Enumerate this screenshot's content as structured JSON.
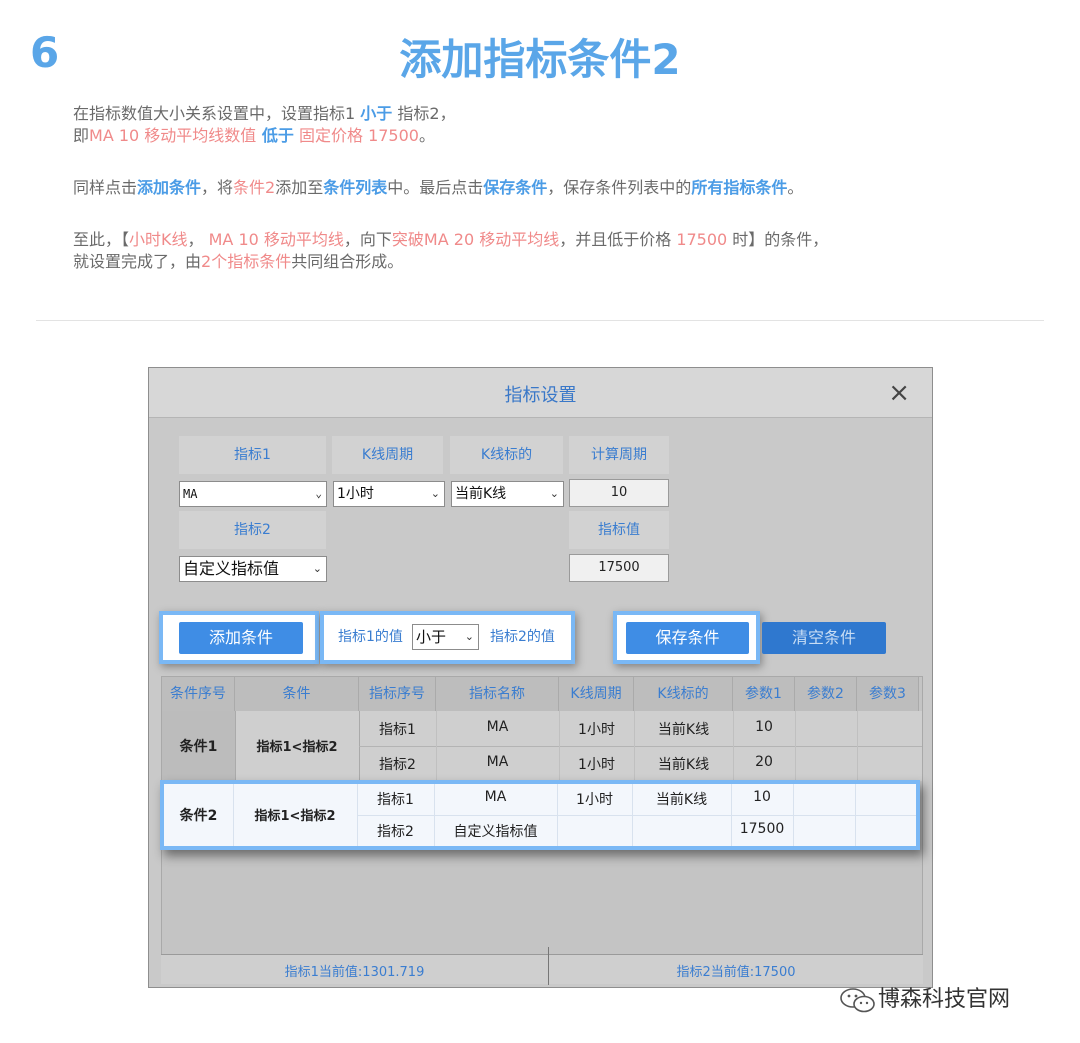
{
  "article": {
    "step_number": "6",
    "title": "添加指标条件2",
    "para1": {
      "line1_a": "在指标数值大小关系设置中，设置指标1 ",
      "line1_b": "小于",
      "line1_c": " 指标2，",
      "line2_a": "即",
      "line2_b": "MA 10 移动平均线数值",
      "line2_c": " 低于",
      "line2_d": " 固定价格 17500",
      "line2_e": "。"
    },
    "para2": {
      "a": "同样点击",
      "b": "添加条件",
      "c": "，将",
      "d": "条件2",
      "e": "添加至",
      "f": "条件列表",
      "g": "中。最后点击",
      "h": "保存条件",
      "i": "，保存条件列表中的",
      "j": "所有指标条件",
      "k": "。"
    },
    "para3": {
      "line1_a": "至此，【",
      "line1_b": "小时K线",
      "line1_c": "， ",
      "line1_d": "MA 10 移动平均线",
      "line1_e": "，向下",
      "line1_f": "突破MA 20 移动平均线",
      "line1_g": "，并且低于价格 ",
      "line1_h": "17500",
      "line1_i": " 时】的条件，",
      "line2_a": "就设置完成了，由",
      "line2_b": "2个指标条件",
      "line2_c": "共同组合形成。"
    }
  },
  "dialog": {
    "title": "指标设置",
    "close": "×",
    "labels": {
      "indicator1": "指标1",
      "kline_period": "K线周期",
      "kline_target": "K线标的",
      "calc_period": "计算周期",
      "indicator2": "指标2",
      "indicator_value": "指标值"
    },
    "values": {
      "indicator1": "MA",
      "kline_period": "1小时",
      "kline_target": "当前K线",
      "calc_period": "10",
      "indicator2": "自定义指标值",
      "indicator_value": "17500"
    },
    "buttons": {
      "add": "添加条件",
      "save": "保存条件",
      "clear": "清空条件"
    },
    "compare": {
      "left": "指标1的值",
      "operator": "小于",
      "right": "指标2的值"
    },
    "table": {
      "headers": [
        "条件序号",
        "条件",
        "指标序号",
        "指标名称",
        "K线周期",
        "K线标的",
        "参数1",
        "参数2",
        "参数3"
      ],
      "conditions": [
        {
          "seq": "条件1",
          "cond": "指标1<指标2",
          "rows": [
            {
              "idx": "指标1",
              "name": "MA",
              "period": "1小时",
              "target": "当前K线",
              "p1": "10"
            },
            {
              "idx": "指标2",
              "name": "MA",
              "period": "1小时",
              "target": "当前K线",
              "p1": "20"
            }
          ]
        },
        {
          "seq": "条件2",
          "cond": "指标1<指标2",
          "rows": [
            {
              "idx": "指标1",
              "name": "MA",
              "period": "1小时",
              "target": "当前K线",
              "p1": "10"
            },
            {
              "idx": "指标2",
              "name": "自定义指标值",
              "period": "",
              "target": "",
              "p1": "17500"
            }
          ]
        }
      ]
    },
    "status": {
      "left": "指标1当前值:1301.719",
      "right": "指标2当前值:17500"
    }
  },
  "watermark": "博森科技官网",
  "colors": {
    "accent_blue": "#4b9ce6",
    "accent_red": "#f08a8a",
    "highlight_border": "#7ab8f5",
    "button_blue": "#3f8de5"
  }
}
